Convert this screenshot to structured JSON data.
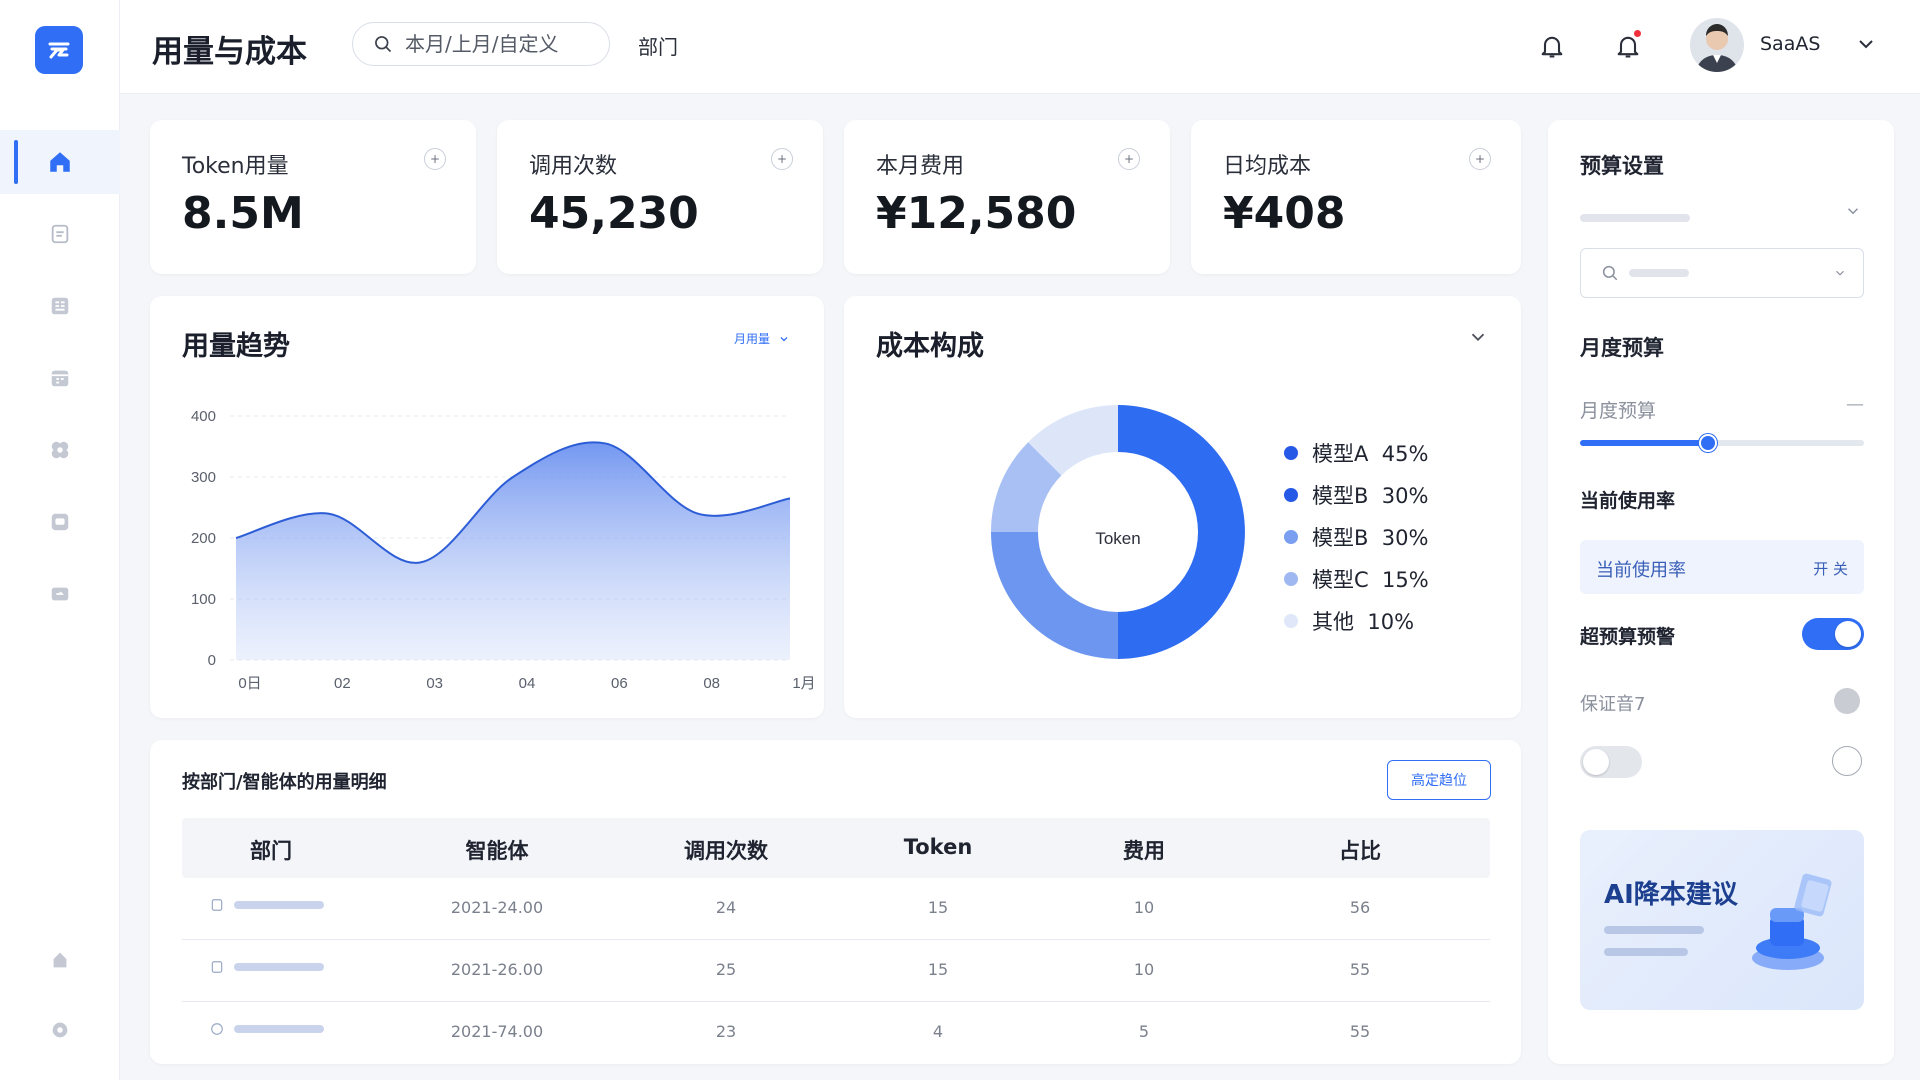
{
  "header": {
    "title": "用量与成本",
    "search_placeholder": "本月/上月/自定义",
    "dept_link": "部门",
    "user_name": "SaaAS"
  },
  "stats": [
    {
      "label": "Token用量",
      "value": "8.5M"
    },
    {
      "label": "调用次数",
      "value": "45,230"
    },
    {
      "label": "本月费用",
      "value": "¥12,580"
    },
    {
      "label": "日均成本",
      "value": "¥408"
    }
  ],
  "usage_trend": {
    "title": "用量趋势",
    "filter_label": "月用量",
    "chart_data": {
      "type": "area",
      "x": [
        "0日",
        "02",
        "03",
        "04",
        "06",
        "08",
        "1月"
      ],
      "values": [
        200,
        240,
        160,
        300,
        355,
        240,
        265
      ],
      "yticks": [
        0,
        100,
        200,
        300,
        400
      ],
      "ylim": [
        0,
        400
      ],
      "color": "#3b6ff0"
    }
  },
  "cost_breakdown": {
    "title": "成本构成",
    "center_label": "Token",
    "chart_data": {
      "type": "pie",
      "labels": [
        "模型A",
        "模型B",
        "模型B",
        "模型C",
        "其他"
      ],
      "display_values": [
        "45%",
        "30%",
        "30%",
        "15%",
        "10%"
      ],
      "slices": [
        {
          "name": "模型A",
          "value": 50,
          "color": "#2e6cf2"
        },
        {
          "name": "模型B",
          "value": 25,
          "color": "#6c96ef"
        },
        {
          "name": "模型C",
          "value": 12.5,
          "color": "#a8c0f3"
        },
        {
          "name": "其他",
          "value": 12.5,
          "color": "#dde6f8"
        }
      ],
      "legend_colors": [
        "#2659e6",
        "#2659e6",
        "#7a9ef0",
        "#9fb8f2",
        "#dfe7f8"
      ]
    }
  },
  "detail_table": {
    "title": "按部门/智能体的用量明细",
    "action_label": "高定趋位",
    "columns": [
      "部门",
      "智能体",
      "调用次数",
      "Token",
      "费用",
      "占比"
    ],
    "rows": [
      {
        "agent": "2021-24.00",
        "calls": "24",
        "token": "15",
        "cost": "10",
        "share": "56"
      },
      {
        "agent": "2021-26.00",
        "calls": "25",
        "token": "15",
        "cost": "10",
        "share": "55"
      },
      {
        "agent": "2021-74.00",
        "calls": "23",
        "token": "4",
        "cost": "5",
        "share": "55"
      }
    ]
  },
  "budget_panel": {
    "title": "预算设置",
    "monthly_budget_heading": "月度预算",
    "monthly_budget_label": "月度预算",
    "monthly_budget_dash": "—",
    "slider_fraction": 0.45,
    "current_usage_heading": "当前使用率",
    "current_usage_label": "当前使用率",
    "switch_text": "开 关",
    "over_budget_label": "超预算预警",
    "over_budget_enabled": true,
    "extra_option_label": "保证音7",
    "ai_title": "AI降本建议"
  },
  "colors": {
    "accent": "#2f6ef5",
    "background": "#f4f6f9"
  },
  "icons": {
    "sidebar": [
      "home-icon",
      "document-icon",
      "list-icon",
      "calendar-icon",
      "puzzle-icon",
      "inbox-icon",
      "ticket-icon",
      "lock-icon",
      "settings-icon"
    ]
  }
}
